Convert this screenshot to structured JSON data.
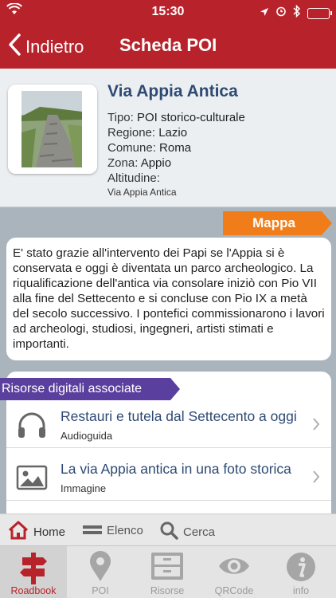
{
  "status_bar": {
    "time": "15:30"
  },
  "nav": {
    "back_label": "Indietro",
    "title": "Scheda POI"
  },
  "poi": {
    "title": "Via Appia Antica",
    "fields": [
      {
        "label": "Tipo: ",
        "value": "POI storico-culturale"
      },
      {
        "label": "Regione: ",
        "value": "Lazio"
      },
      {
        "label": "Comune: ",
        "value": "Roma"
      },
      {
        "label": "Zona: ",
        "value": "Appio"
      },
      {
        "label": "Altitudine:",
        "value": ""
      }
    ],
    "caption": "Via Appia Antica"
  },
  "map_button": {
    "label": "Mappa",
    "color": "#f07d1a"
  },
  "description": "E' stato grazie all'intervento dei Papi se l'Appia si è conservata e oggi è diventata un parco archeologico. La riqualificazione dell'antica via consolare iniziò con Pio VII alla fine del Settecento e si concluse con Pio IX a metà del secolo successivo. I pontefici commissionarono i lavori ad archeologi, studiosi, ingegneri, artisti stimati e importanti.",
  "resources": {
    "header": "Risorse digitali associate",
    "header_color": "#5b3f9e",
    "items": [
      {
        "title": "Restauri e tutela dal Settecento a oggi",
        "type": "Audioguida",
        "icon": "headphones-icon"
      },
      {
        "title": "La via Appia antica in una foto storica",
        "type": "Immagine",
        "icon": "image-icon"
      }
    ]
  },
  "subtabs": [
    {
      "label": "Home",
      "icon": "home-icon",
      "active": true
    },
    {
      "label": "Elenco",
      "icon": "list-icon",
      "active": false
    },
    {
      "label": "Cerca",
      "icon": "search-icon",
      "active": false
    }
  ],
  "tabbar": [
    {
      "label": "Roadbook",
      "icon": "signpost-icon",
      "active": true
    },
    {
      "label": "POI",
      "icon": "map-pin-icon",
      "active": false
    },
    {
      "label": "Risorse",
      "icon": "cabinet-icon",
      "active": false
    },
    {
      "label": "QRCode",
      "icon": "eye-icon",
      "active": false
    },
    {
      "label": "info",
      "icon": "info-icon",
      "active": false
    }
  ],
  "colors": {
    "brand_red": "#b8232b",
    "title_blue": "#2e4a73"
  }
}
